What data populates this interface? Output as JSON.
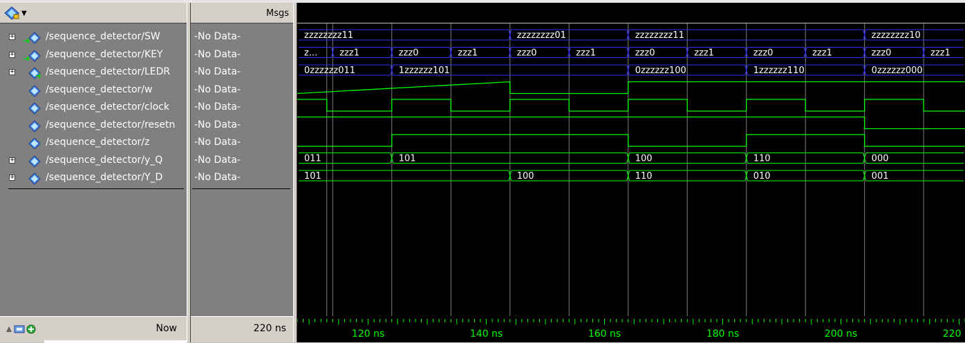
{
  "msgs_header": "Msgs",
  "signals": [
    {
      "name": "/sequence_detector/SW",
      "msg": "-No Data-",
      "expandable": true,
      "icon": "bus-input-icon"
    },
    {
      "name": "/sequence_detector/KEY",
      "msg": "-No Data-",
      "expandable": true,
      "icon": "bus-input-icon"
    },
    {
      "name": "/sequence_detector/LEDR",
      "msg": "-No Data-",
      "expandable": true,
      "icon": "bus-output-icon"
    },
    {
      "name": "/sequence_detector/w",
      "msg": "-No Data-",
      "expandable": false,
      "icon": "signal-icon"
    },
    {
      "name": "/sequence_detector/clock",
      "msg": "-No Data-",
      "expandable": false,
      "icon": "signal-icon"
    },
    {
      "name": "/sequence_detector/resetn",
      "msg": "-No Data-",
      "expandable": false,
      "icon": "signal-icon"
    },
    {
      "name": "/sequence_detector/z",
      "msg": "-No Data-",
      "expandable": false,
      "icon": "signal-icon"
    },
    {
      "name": "/sequence_detector/y_Q",
      "msg": "-No Data-",
      "expandable": true,
      "icon": "bus-icon"
    },
    {
      "name": "/sequence_detector/Y_D",
      "msg": "-No Data-",
      "expandable": true,
      "icon": "bus-icon"
    }
  ],
  "now": {
    "label": "Now",
    "value": "220 ns"
  },
  "colors": {
    "wave": "#00ff00",
    "bus": "#3030ff",
    "grid": "#808080",
    "text": "#ffffff",
    "ruler": "#00ff00"
  },
  "waveform": {
    "time_start_ns": 108,
    "time_end_ns": 221,
    "ruler_ticks": [
      "120 ns",
      "140 ns",
      "160 ns",
      "180 ns",
      "200 ns",
      "220 ns"
    ],
    "ruler_tick_values_ns": [
      120,
      140,
      160,
      180,
      200,
      220
    ],
    "buses": [
      {
        "signal": "SW",
        "segments": [
          {
            "t": 108,
            "label": "zzzzzzzz11"
          },
          {
            "t": 144,
            "label": "zzzzzzzz01"
          },
          {
            "t": 164,
            "label": "zzzzzzzz11"
          },
          {
            "t": 204,
            "label": "zzzzzzzz10"
          }
        ]
      },
      {
        "signal": "KEY",
        "segments": [
          {
            "t": 108,
            "label": "z..."
          },
          {
            "t": 114,
            "label": "zzz1"
          },
          {
            "t": 124,
            "label": "zzz0"
          },
          {
            "t": 134,
            "label": "zzz1"
          },
          {
            "t": 144,
            "label": "zzz0"
          },
          {
            "t": 154,
            "label": "zzz1"
          },
          {
            "t": 164,
            "label": "zzz0"
          },
          {
            "t": 174,
            "label": "zzz1"
          },
          {
            "t": 184,
            "label": "zzz0"
          },
          {
            "t": 194,
            "label": "zzz1"
          },
          {
            "t": 204,
            "label": "zzz0"
          },
          {
            "t": 214,
            "label": "zzz1"
          }
        ]
      },
      {
        "signal": "LEDR",
        "segments": [
          {
            "t": 108,
            "label": "0zzzzzz011"
          },
          {
            "t": 124,
            "label": "1zzzzzz101"
          },
          {
            "t": 164,
            "label": "0zzzzzz100"
          },
          {
            "t": 184,
            "label": "1zzzzzz110"
          },
          {
            "t": 204,
            "label": "0zzzzzz000"
          }
        ]
      },
      {
        "signal": "y_Q",
        "segments": [
          {
            "t": 108,
            "label": "011"
          },
          {
            "t": 124,
            "label": "101"
          },
          {
            "t": 164,
            "label": "100"
          },
          {
            "t": 184,
            "label": "110"
          },
          {
            "t": 204,
            "label": "000"
          }
        ]
      },
      {
        "signal": "Y_D",
        "segments": [
          {
            "t": 108,
            "label": "101"
          },
          {
            "t": 144,
            "label": "100"
          },
          {
            "t": 164,
            "label": "110"
          },
          {
            "t": 184,
            "label": "010"
          },
          {
            "t": 204,
            "label": "001"
          }
        ]
      }
    ],
    "digital": [
      {
        "signal": "w",
        "points": [
          [
            108,
            0
          ],
          [
            144,
            1
          ],
          [
            144,
            0
          ],
          [
            164,
            0
          ],
          [
            164,
            1
          ]
        ]
      },
      {
        "signal": "clock",
        "points": [
          [
            108,
            1
          ],
          [
            113,
            1
          ],
          [
            113,
            0
          ],
          [
            124,
            0
          ],
          [
            124,
            1
          ],
          [
            134,
            1
          ],
          [
            134,
            0
          ],
          [
            144,
            0
          ],
          [
            144,
            1
          ],
          [
            154,
            1
          ],
          [
            154,
            0
          ],
          [
            164,
            0
          ],
          [
            164,
            1
          ],
          [
            174,
            1
          ],
          [
            174,
            0
          ],
          [
            184,
            0
          ],
          [
            184,
            1
          ],
          [
            194,
            1
          ],
          [
            194,
            0
          ],
          [
            204,
            0
          ],
          [
            204,
            1
          ],
          [
            214,
            1
          ],
          [
            214,
            0
          ]
        ]
      },
      {
        "signal": "resetn",
        "points": [
          [
            108,
            1
          ],
          [
            204,
            1
          ],
          [
            204,
            0
          ]
        ]
      },
      {
        "signal": "z",
        "points": [
          [
            108,
            0
          ],
          [
            124,
            0
          ],
          [
            124,
            1
          ],
          [
            164,
            1
          ],
          [
            164,
            0
          ],
          [
            184,
            0
          ],
          [
            184,
            1
          ],
          [
            204,
            1
          ],
          [
            204,
            0
          ]
        ]
      }
    ]
  }
}
